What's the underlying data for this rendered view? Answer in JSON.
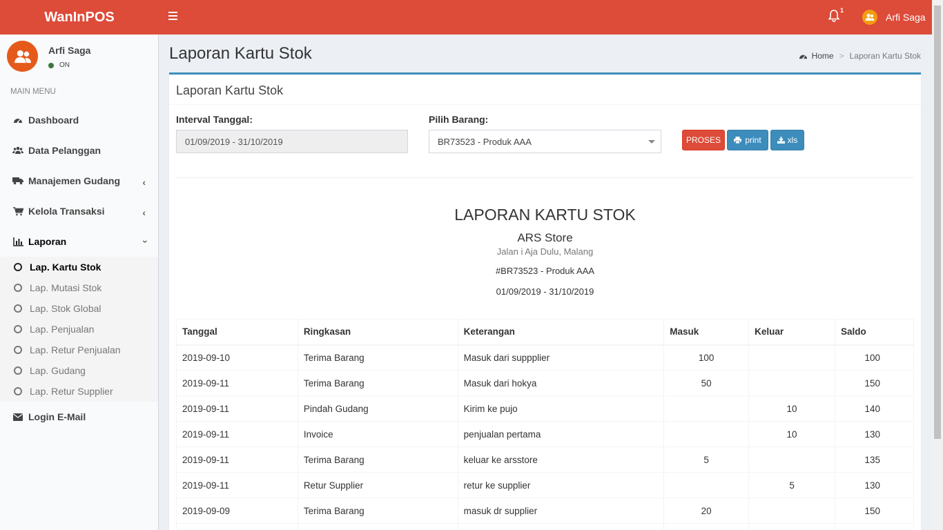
{
  "app": {
    "logo": "WanInPOS",
    "notif_count": "1",
    "user_name": "Arfi Saga"
  },
  "sidebar": {
    "user_name": "Arfi Saga",
    "status": "ON",
    "header": "MAIN MENU",
    "items": [
      {
        "label": "Dashboard",
        "icon": "dashboard-icon"
      },
      {
        "label": "Data Pelanggan",
        "icon": "users-icon"
      },
      {
        "label": "Manajemen Gudang",
        "icon": "truck-icon"
      },
      {
        "label": "Kelola Transaksi",
        "icon": "cart-icon"
      },
      {
        "label": "Laporan",
        "icon": "bar-chart-icon"
      },
      {
        "label": "Login E-Mail",
        "icon": "envelope-icon"
      }
    ],
    "sub_items": [
      "Lap. Kartu Stok",
      "Lap. Mutasi Stok",
      "Lap. Stok Global",
      "Lap. Penjualan",
      "Lap. Retur Penjualan",
      "Lap. Gudang",
      "Lap. Retur Supplier"
    ]
  },
  "page": {
    "title": "Laporan Kartu Stok",
    "breadcrumb_home": "Home",
    "breadcrumb_current": "Laporan Kartu Stok"
  },
  "box": {
    "title": "Laporan Kartu Stok",
    "interval_label": "Interval Tanggal:",
    "interval_value": "01/09/2019 - 31/10/2019",
    "barang_label": "Pilih Barang:",
    "barang_value": "BR73523 - Produk AAA",
    "btn_proses": "PROSES",
    "btn_print": "print",
    "btn_xls": "xls"
  },
  "report": {
    "title": "LAPORAN KARTU STOK",
    "store": "ARS Store",
    "address": "Jalan i Aja Dulu, Malang",
    "item": "#BR73523 - Produk AAA",
    "range": "01/09/2019 - 31/10/2019",
    "columns": [
      "Tanggal",
      "Ringkasan",
      "Keterangan",
      "Masuk",
      "Keluar",
      "Saldo"
    ],
    "rows": [
      [
        "2019-09-10",
        "Terima Barang",
        "Masuk dari suppplier",
        "100",
        "",
        "100"
      ],
      [
        "2019-09-11",
        "Terima Barang",
        "Masuk dari hokya",
        "50",
        "",
        "150"
      ],
      [
        "2019-09-11",
        "Pindah Gudang",
        "Kirim ke pujo",
        "",
        "10",
        "140"
      ],
      [
        "2019-09-11",
        "Invoice",
        "penjualan pertama",
        "",
        "10",
        "130"
      ],
      [
        "2019-09-11",
        "Terima Barang",
        "keluar ke arsstore",
        "5",
        "",
        "135"
      ],
      [
        "2019-09-11",
        "Retur Supplier",
        "retur ke supplier",
        "",
        "5",
        "130"
      ],
      [
        "2019-09-09",
        "Terima Barang",
        "masuk dr supplier",
        "20",
        "",
        "150"
      ]
    ]
  }
}
